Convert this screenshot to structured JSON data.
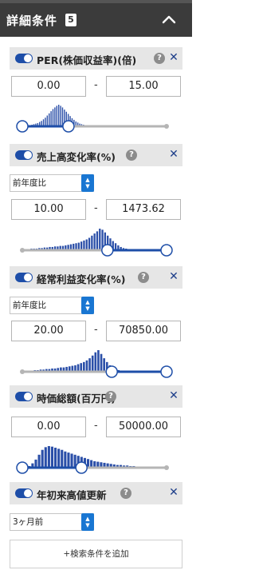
{
  "header": {
    "title": "詳細条件",
    "count": "5"
  },
  "sections": [
    {
      "key": "per",
      "title": "PER(株価収益率)(倍)",
      "min_value": "0.00",
      "max_value": "15.00",
      "histogram": [
        2,
        3,
        4,
        5,
        6,
        8,
        10,
        13,
        16,
        20,
        24,
        28,
        32,
        35,
        38,
        40,
        38,
        35,
        31,
        27,
        23,
        19,
        15,
        12,
        9,
        7,
        5,
        4,
        3,
        2,
        2,
        1,
        1,
        1
      ],
      "hist_start": 0.05,
      "hist_end": 0.5,
      "slider_min": 0.0,
      "slider_max": 0.32
    },
    {
      "key": "sales",
      "title": "売上高変化率(%)",
      "period": "前年度比",
      "min_value": "10.00",
      "max_value": "1473.62",
      "histogram": [
        2,
        2,
        3,
        3,
        3,
        4,
        4,
        5,
        5,
        6,
        6,
        7,
        7,
        8,
        8,
        9,
        10,
        11,
        12,
        13,
        14,
        16,
        18,
        20,
        23,
        27,
        31,
        35,
        40,
        38,
        33,
        27,
        22,
        17,
        13,
        9,
        6,
        4,
        3,
        2
      ],
      "hist_start": 0.02,
      "hist_end": 0.75,
      "slider_min": 0.59,
      "slider_max": 1.0
    },
    {
      "key": "ordinary_profit",
      "title": "経常利益変化率(%)",
      "period": "前年度比",
      "min_value": "20.00",
      "max_value": "70850.00",
      "histogram": [
        1,
        2,
        2,
        3,
        3,
        4,
        4,
        5,
        5,
        6,
        6,
        7,
        8,
        8,
        9,
        10,
        11,
        12,
        14,
        16,
        18,
        21,
        25,
        30,
        36,
        40,
        33,
        25,
        18,
        12,
        8,
        5,
        3,
        2,
        1
      ],
      "hist_start": 0.02,
      "hist_end": 0.72,
      "slider_min": 0.62,
      "slider_max": 1.0
    },
    {
      "key": "market_cap",
      "title": "時価総額(百万円)",
      "min_value": "0.00",
      "max_value": "50000.00",
      "histogram": [
        3,
        8,
        15,
        24,
        33,
        38,
        40,
        39,
        37,
        35,
        33,
        30,
        28,
        26,
        24,
        22,
        20,
        18,
        16,
        14,
        12,
        11,
        10,
        9,
        8,
        7,
        6,
        5,
        5,
        4,
        4,
        3,
        3,
        2,
        2,
        2,
        1,
        1
      ],
      "hist_start": 0.04,
      "hist_end": 0.9,
      "slider_min": 0.0,
      "slider_max": 0.41
    },
    {
      "key": "ytd_high",
      "title": "年初来高値更新",
      "period": "3ヶ月前"
    }
  ],
  "add_condition_label": "+検索条件を追加",
  "colors": {
    "header_bg": "#3b3b3b",
    "accent": "#1e4ea8",
    "bar_fill": "#2b4fa8",
    "select_arrow": "#1976d2"
  },
  "icons": {
    "collapse": "chevron-up-icon",
    "help": "help-circle-icon",
    "remove": "close-icon"
  }
}
